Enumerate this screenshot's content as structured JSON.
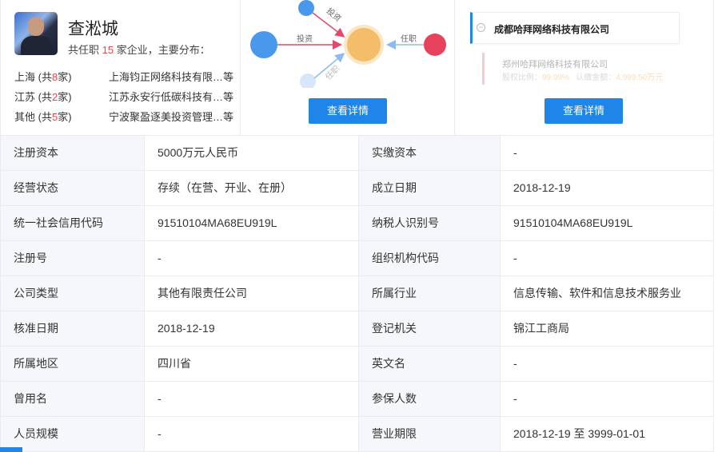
{
  "person": {
    "name": "查淞城",
    "summary_prefix": "共任职 ",
    "count": "15",
    "summary_suffix": " 家企业，主要分布：",
    "distribution": [
      {
        "region": "上海 (共",
        "n": "8",
        "unit": "家)",
        "company": "上海钧正网络科技有限…等"
      },
      {
        "region": "江苏 (共",
        "n": "2",
        "unit": "家)",
        "company": "江苏永安行低碳科技有…等"
      },
      {
        "region": "其他 (共",
        "n": "5",
        "unit": "家)",
        "company": "宁波聚盈逐美投资管理…等"
      }
    ]
  },
  "graph": {
    "edge_invest": "投资",
    "edge_invest2": "投资",
    "edge_role": "任职",
    "edge_role2": "任职",
    "button": "查看详情"
  },
  "tree": {
    "root": "成都哈拜网络科技有限公司",
    "child": "郑州哈拜网络科技有限公司",
    "ratio_label": "股权比例：",
    "ratio": "99.99%",
    "amount_label": "认缴金额：",
    "amount": "4,999.50万元",
    "button": "查看详情"
  },
  "rows": [
    [
      "注册资本",
      "5000万元人民币",
      "实缴资本",
      "-"
    ],
    [
      "经营状态",
      "存续（在营、开业、在册）",
      "成立日期",
      "2018-12-19"
    ],
    [
      "统一社会信用代码",
      "91510104MA68EU919L",
      "纳税人识别号",
      "91510104MA68EU919L"
    ],
    [
      "注册号",
      "-",
      "组织机构代码",
      "-"
    ],
    [
      "公司类型",
      "其他有限责任公司",
      "所属行业",
      "信息传输、软件和信息技术服务业"
    ],
    [
      "核准日期",
      "2018-12-19",
      "登记机关",
      "锦江工商局"
    ],
    [
      "所属地区",
      "四川省",
      "英文名",
      "-"
    ],
    [
      "曾用名",
      "-",
      "参保人数",
      "-"
    ],
    [
      "人员规模",
      "-",
      "营业期限",
      "2018-12-19 至 3999-01-01"
    ]
  ]
}
